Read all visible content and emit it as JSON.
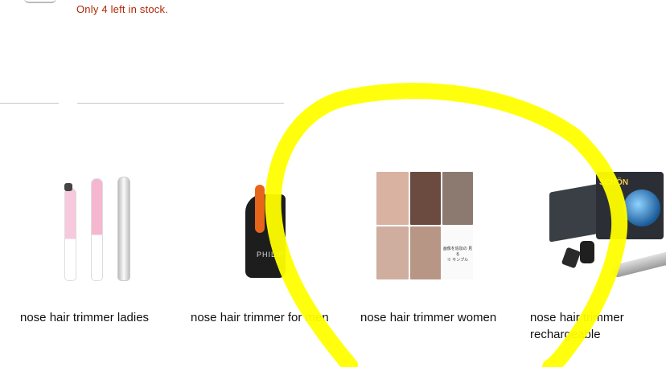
{
  "availability": {
    "stock_text": "Only 4 left in stock."
  },
  "related_searches": [
    {
      "label": "nose hair trimmer ladies"
    },
    {
      "label": "nose hair trimmer for men",
      "brand": "PHILIPS"
    },
    {
      "label": "nose hair trimmer women",
      "note_lines": [
        "画像を追加の 見る",
        "※ サンプル"
      ]
    },
    {
      "label": "nose hair trimmer rechargeable",
      "brand": "SCHÖN"
    }
  ],
  "colors": {
    "stock": "#b12704",
    "annotation": "#ffff00"
  }
}
